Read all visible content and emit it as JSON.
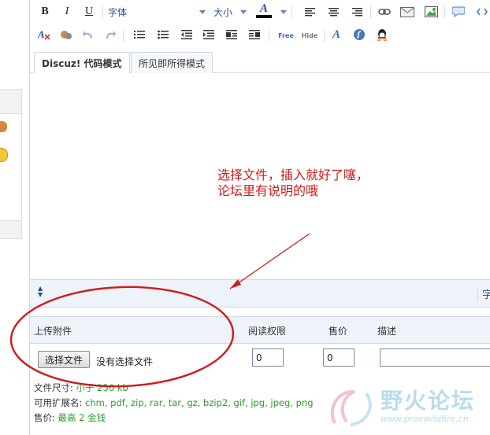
{
  "toolbar": {
    "bold": "B",
    "italic": "I",
    "underline": "U",
    "font_select": "字体",
    "size_select": "大小",
    "color_letter": "A",
    "free_label": "Free",
    "hide_label": "Hide",
    "row2_font_letter": "A"
  },
  "tabs": [
    {
      "label": "Discuz! 代码模式",
      "active": true
    },
    {
      "label": "所见即所得模式",
      "active": false
    }
  ],
  "annotation": {
    "line1": "选择文件，插入就好了噻，",
    "line2": "论坛里有说明的哦"
  },
  "resize_edge_char": "字",
  "upload": {
    "headers": {
      "file": "上传附件",
      "read_perm": "阅读权限",
      "price": "售价",
      "desc": "描述"
    },
    "choose_button": "选择文件",
    "no_file": "没有选择文件",
    "read_perm_value": "0",
    "price_value": "0",
    "desc_value": "",
    "size_label": "文件尺寸:",
    "size_value": "小于 250 kb",
    "ext_label": "可用扩展名:",
    "ext_value": "chm, pdf, zip, rar, tar, gz, bzip2, gif, jpg, jpeg, png",
    "price_label": "售价:",
    "price_limit": "最高 2 金钱"
  },
  "watermark": {
    "title": "野火论坛",
    "url": "www.proewildfire.cn"
  },
  "colors": {
    "annotation": "#d11a1a",
    "accent_blue": "#2a4e8c",
    "panel_bg": "#eef3f9",
    "green_text": "#2c9a2c"
  }
}
